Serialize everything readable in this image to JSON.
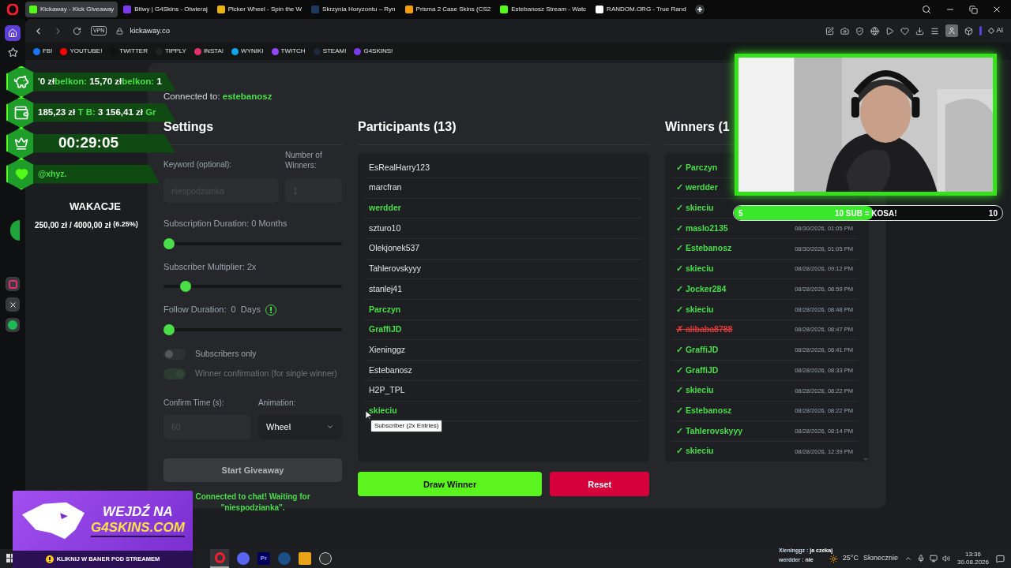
{
  "browser": {
    "tabs": [
      {
        "title": "Kickaway - Kick Giveaway",
        "selected": true
      },
      {
        "title": "Bitwy | G4Skins - Otwieraj",
        "selected": false
      },
      {
        "title": "Picker Wheel - Spin the W",
        "selected": false
      },
      {
        "title": "Skrzynia Horyzontu – Ryn",
        "selected": false
      },
      {
        "title": "Prisma 2 Case Skins (CS2",
        "selected": false
      },
      {
        "title": "Estebanosz Stream - Watc",
        "selected": false
      },
      {
        "title": "RANDOM.ORG - True Rand",
        "selected": false
      }
    ],
    "vpn_label": "VPN",
    "address": "kickaway.co",
    "ai_label": "AI",
    "bookmarks": [
      "FB!",
      "YOUTUBE!",
      "TWITTER",
      "TIPPLY",
      "INSTA!",
      "WYNIKI",
      "TWITCH",
      "STEAM!",
      "G4SKINS!"
    ]
  },
  "stream_overlay": {
    "tickers": [
      [
        {
          "text": "'0 zł",
          "accent": false
        },
        {
          "text": "belkon:",
          "accent": true
        },
        {
          "text": " 15,70 zł",
          "accent": false
        },
        {
          "text": "belkon:",
          "accent": true
        },
        {
          "text": " 1",
          "accent": false
        }
      ],
      [
        {
          "text": "185,23 zł ",
          "accent": false
        },
        {
          "text": "T B:",
          "accent": true
        },
        {
          "text": " 3 156,41 zł ",
          "accent": false
        },
        {
          "text": "Gr",
          "accent": true
        }
      ]
    ],
    "timer": "00:29:05",
    "handle": "@xhyz.",
    "goal_title": "WAKACJE",
    "goal_amount": "250,00 zł / 4000,00 zł",
    "goal_percent": "(6.25%)"
  },
  "page": {
    "connected_label": "Connected to:",
    "channel": "estebanosz",
    "settings": {
      "title": "Settings",
      "keyword_label": "Keyword (optional):",
      "keyword_placeholder": "niespodzianka",
      "winners_label": "Number of Winners:",
      "winners_placeholder": "1",
      "sliders": [
        {
          "label": "Subscription Duration: 0 Months",
          "level": 0,
          "info": false
        },
        {
          "label": "Subscriber Multiplier: 2x",
          "level": 0.1,
          "info": false
        },
        {
          "label": "Follow Duration:  0  Days",
          "level": 0,
          "info": true
        }
      ],
      "toggles": [
        {
          "label": "Subscribers only",
          "on": false,
          "disabled": false
        },
        {
          "label": "Winner confirmation (for single winner)",
          "on": true,
          "disabled": true
        }
      ],
      "confirm_label": "Confirm Time (s):",
      "confirm_placeholder": "60",
      "animation_label": "Animation:",
      "animation_value": "Wheel",
      "start_button": "Start Giveaway",
      "status": "Connected to chat! Waiting for \"niespodzianka\"."
    },
    "participants": {
      "title": "Participants (13)",
      "tooltip": "Subscriber (2x Entries)",
      "items": [
        {
          "name": "EsRealHarry123",
          "subscriber": false
        },
        {
          "name": "marcfran",
          "subscriber": false
        },
        {
          "name": "werdder",
          "subscriber": true
        },
        {
          "name": "szturo10",
          "subscriber": false
        },
        {
          "name": "Olekjonek537",
          "subscriber": false
        },
        {
          "name": "Tahlerovskyyy",
          "subscriber": false
        },
        {
          "name": "stanlej41",
          "subscriber": false
        },
        {
          "name": "Parczyn",
          "subscriber": true
        },
        {
          "name": "GraffiJD",
          "subscriber": true
        },
        {
          "name": "Xieninggz",
          "subscriber": false
        },
        {
          "name": "Estebanosz",
          "subscriber": false
        },
        {
          "name": "H2P_TPL",
          "subscriber": false
        },
        {
          "name": "skieciu",
          "subscriber": true
        }
      ]
    },
    "draw_button": "Draw Winner",
    "reset_button": "Reset",
    "winners": {
      "title": "Winners (1",
      "items": [
        {
          "mark": "✓",
          "name": "Parczyn",
          "confirmed": true
        },
        {
          "mark": "✓",
          "name": "werdder",
          "confirmed": true
        },
        {
          "mark": "✓",
          "name": "skieciu",
          "confirmed": true
        },
        {
          "mark": "✓",
          "name": "maslo2135",
          "confirmed": true,
          "date": "08/30/2026, 01:05 PM"
        },
        {
          "mark": "✓",
          "name": "Estebanosz",
          "confirmed": true,
          "date": "08/30/2026, 01:05 PM"
        },
        {
          "mark": "✓",
          "name": "skieciu",
          "confirmed": true,
          "date": "08/28/2026, 09:12 PM"
        },
        {
          "mark": "✓",
          "name": "Jocker284",
          "confirmed": true,
          "date": "08/28/2026, 08:59 PM"
        },
        {
          "mark": "✓",
          "name": "skieciu",
          "confirmed": true,
          "date": "08/28/2026, 08:48 PM"
        },
        {
          "mark": "✗",
          "name": "alibaba8788",
          "confirmed": false,
          "date": "08/28/2026, 08:47 PM"
        },
        {
          "mark": "✓",
          "name": "GraffiJD",
          "confirmed": true,
          "date": "08/28/2026, 08:41 PM"
        },
        {
          "mark": "✓",
          "name": "GraffiJD",
          "confirmed": true,
          "date": "08/28/2026, 08:33 PM"
        },
        {
          "mark": "✓",
          "name": "skieciu",
          "confirmed": true,
          "date": "08/28/2026, 08:22 PM"
        },
        {
          "mark": "✓",
          "name": "Estebanosz",
          "confirmed": true,
          "date": "08/28/2026, 08:22 PM"
        },
        {
          "mark": "✓",
          "name": "Tahlerovskyyy",
          "confirmed": true,
          "date": "08/28/2026, 08:14 PM"
        },
        {
          "mark": "✓",
          "name": "skieciu",
          "confirmed": true,
          "date": "08/28/2026, 12:39 PM"
        }
      ]
    }
  },
  "webcam": {
    "kind": "picture",
    "goal_start": "5",
    "goal_text": "10 SUB = KOSA!",
    "goal_end": "10",
    "level": 0.52
  },
  "banner": {
    "line1": "WEJDŹ NA",
    "line2": "G4SKINS.COM",
    "cta": "KLIKNIJ W BANER POD STREAMEM"
  },
  "chat": [
    {
      "user": "Xieninggz :",
      "message": "ja czekaj"
    },
    {
      "user": "werdder :",
      "message": "nie"
    }
  ],
  "taskbar": {
    "premiere_label": "Pr",
    "temperature": "25°C",
    "weather": "Słonecznie",
    "time": "13:36",
    "date": "30.08.2026"
  }
}
